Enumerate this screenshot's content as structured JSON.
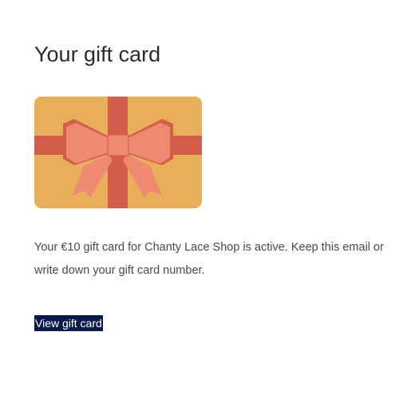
{
  "header": {
    "title": "Your gift card"
  },
  "gift_card": {
    "icon": "gift-card-with-bow-icon",
    "card_color": "#E8AE5A",
    "ribbon_color": "#D45C4B",
    "bow_color": "#EF8A72"
  },
  "body": {
    "message": "Your €10 gift card for Chanty Lace Shop is active. Keep this email or write down your gift card number."
  },
  "actions": {
    "view_gift_card_label": "View gift card",
    "button_color": "#0B1A4B"
  }
}
